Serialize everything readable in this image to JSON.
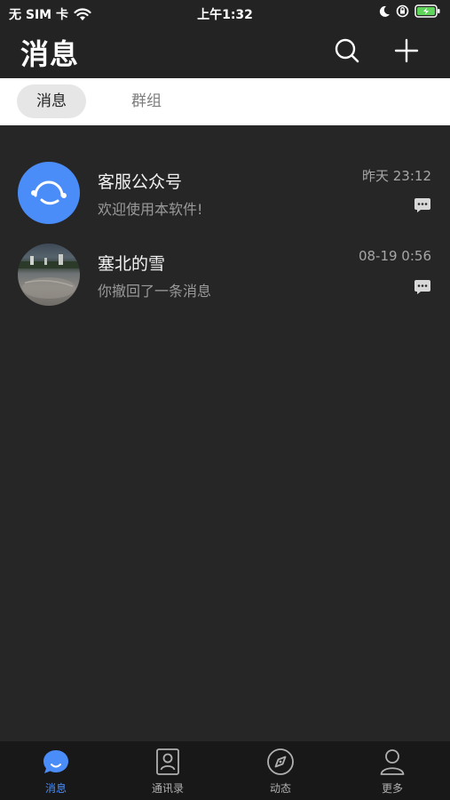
{
  "status_bar": {
    "carrier": "无 SIM 卡",
    "time": "上午1:32"
  },
  "header": {
    "title": "消息",
    "search_icon": "search-icon",
    "add_icon": "plus-icon"
  },
  "segments": [
    {
      "label": "消息",
      "active": true
    },
    {
      "label": "群组",
      "active": false
    }
  ],
  "conversations": [
    {
      "name": "客服公众号",
      "preview": "欢迎使用本软件!",
      "time": "昨天 23:12",
      "avatar": "customer-service-avatar"
    },
    {
      "name": "塞北的雪",
      "preview": "你撤回了一条消息",
      "time": "08-19 0:56",
      "avatar": "photo-avatar"
    }
  ],
  "tabbar": [
    {
      "label": "消息",
      "icon": "chat-bubble-icon",
      "active": true
    },
    {
      "label": "通讯录",
      "icon": "contacts-icon",
      "active": false
    },
    {
      "label": "动态",
      "icon": "compass-icon",
      "active": false
    },
    {
      "label": "更多",
      "icon": "person-icon",
      "active": false
    }
  ],
  "colors": {
    "accent": "#4a8df8",
    "background": "#262626",
    "tabbar": "#181818"
  }
}
